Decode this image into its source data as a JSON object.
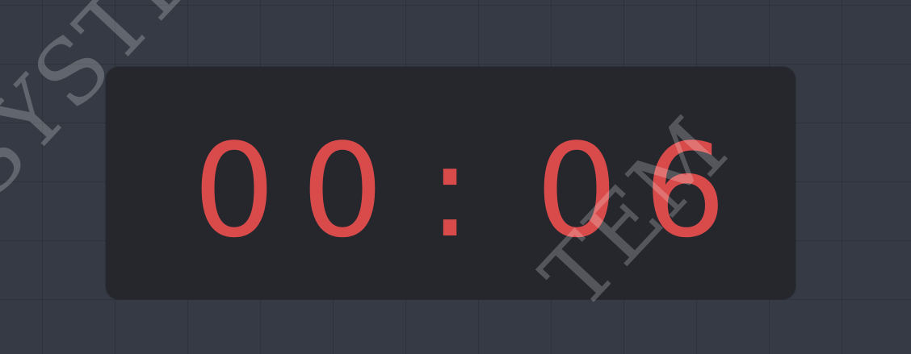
{
  "timer": {
    "minutes_tens": "0",
    "minutes_ones": "0",
    "separator": ":",
    "seconds_tens": "0",
    "seconds_ones": "6",
    "color": "#d94b4b"
  },
  "watermark": {
    "left_text": "SYSTE",
    "right_text": "TEM"
  },
  "colors": {
    "background": "#353a44",
    "panel": "#25272d",
    "digits": "#d94b4b"
  }
}
